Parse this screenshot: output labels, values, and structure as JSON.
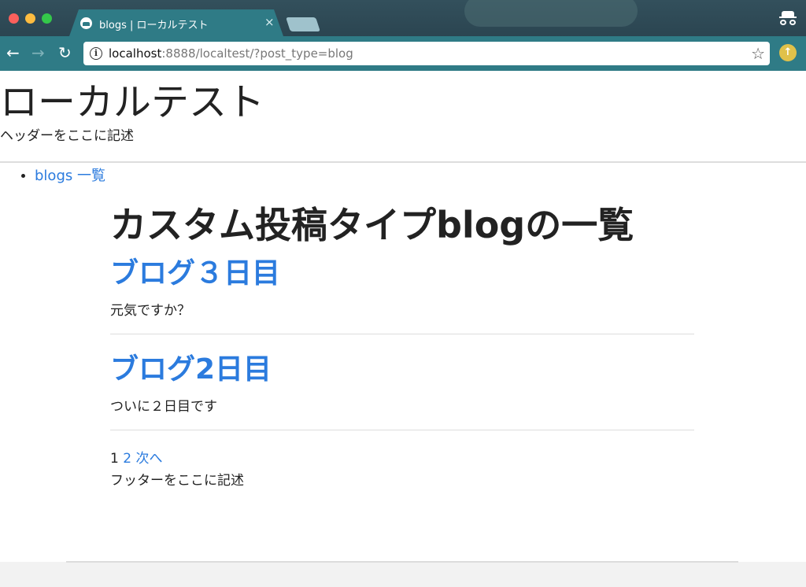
{
  "browser": {
    "tab_title": "blogs | ローカルテスト",
    "tab_close": "×",
    "url_host": "localhost",
    "url_rest": ":8888/localtest/?post_type=blog"
  },
  "site": {
    "title": "ローカルテスト",
    "description": "ヘッダーをここに記述",
    "menu": [
      {
        "label": "blogs 一覧"
      }
    ]
  },
  "archive": {
    "title": "カスタム投稿タイプblogの一覧",
    "posts": [
      {
        "title": "ブログ３日目",
        "excerpt": "元気ですか？"
      },
      {
        "title": "ブログ2日目",
        "excerpt": "ついに２日目です"
      }
    ]
  },
  "pagination": {
    "current": "1",
    "page2": "2",
    "next": "次へ"
  },
  "footer": {
    "text": "フッターをここに記述"
  },
  "colors": {
    "link": "#2b7bde",
    "chrome": "#2f7b86"
  }
}
